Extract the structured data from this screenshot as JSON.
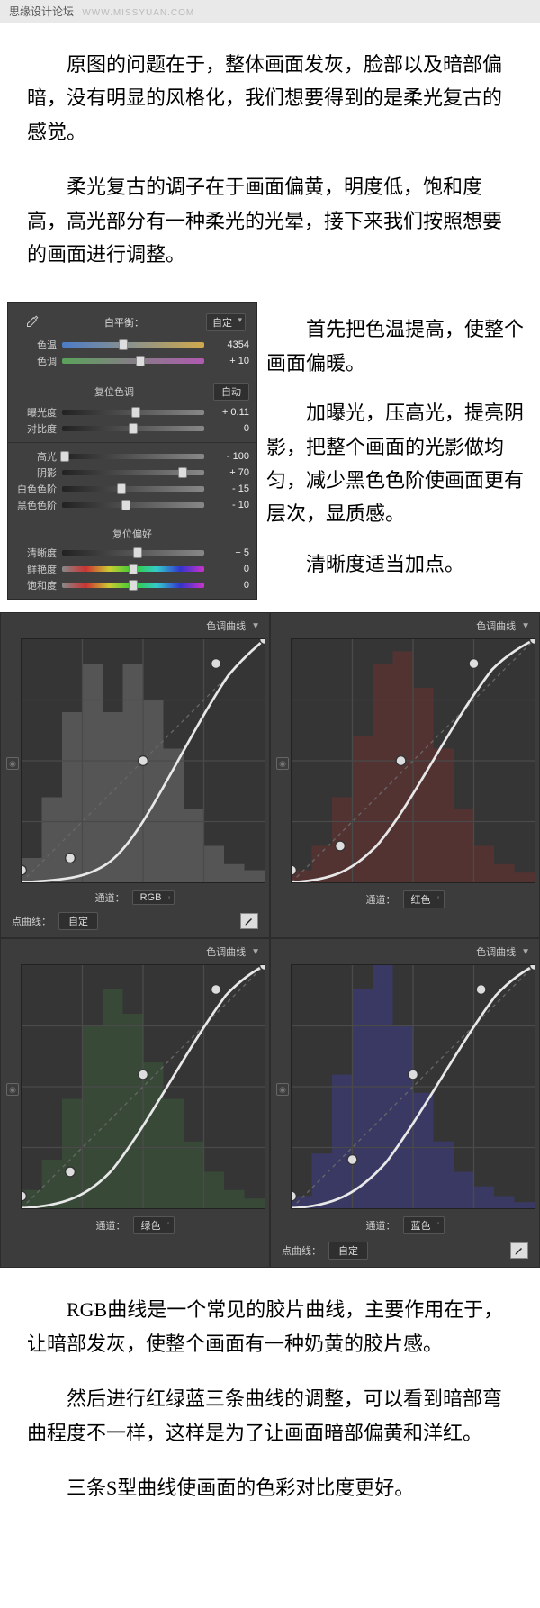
{
  "header": {
    "site": "思缘设计论坛",
    "url": "WWW.MISSYUAN.COM"
  },
  "intro": [
    "原图的问题在于，整体画面发灰，脸部以及暗部偏暗，没有明显的风格化，我们想要得到的是柔光复古的感觉。",
    "柔光复古的调子在于画面偏黄，明度低，饱和度高，高光部分有一种柔光的光晕，接下来我们按照想要的画面进行调整。"
  ],
  "basic": {
    "wb_label": "白平衡：",
    "wb_preset": "自定",
    "sliders1": [
      {
        "label": "色温",
        "value": "4354",
        "pos": 43,
        "track": "temp"
      },
      {
        "label": "色调",
        "value": "+ 10",
        "pos": 55,
        "track": "tint"
      }
    ],
    "section_tone": {
      "title": "复位色调",
      "auto": "自动"
    },
    "sliders2": [
      {
        "label": "曝光度",
        "value": "+ 0.11",
        "pos": 52,
        "track": "dark"
      },
      {
        "label": "对比度",
        "value": "0",
        "pos": 50,
        "track": "dark"
      }
    ],
    "sliders3": [
      {
        "label": "高光",
        "value": "- 100",
        "pos": 2,
        "track": "dark"
      },
      {
        "label": "阴影",
        "value": "+ 70",
        "pos": 85,
        "track": "dark"
      },
      {
        "label": "白色色阶",
        "value": "- 15",
        "pos": 42,
        "track": "dark"
      },
      {
        "label": "黑色色阶",
        "value": "- 10",
        "pos": 45,
        "track": "dark"
      }
    ],
    "section_pref": {
      "title": "复位偏好"
    },
    "sliders4": [
      {
        "label": "清晰度",
        "value": "+ 5",
        "pos": 53,
        "track": "dark"
      },
      {
        "label": "鲜艳度",
        "value": "0",
        "pos": 50,
        "track": "sat"
      },
      {
        "label": "饱和度",
        "value": "0",
        "pos": 50,
        "track": "sat"
      }
    ]
  },
  "basic_side": [
    "首先把色温提高，使整个画面偏暖。",
    "加曝光，压高光，提亮阴影，把整个画面的光影做均匀，减少黑色色阶使画面更有层次，显质感。",
    "清晰度适当加点。"
  ],
  "curves": {
    "title": "色调曲线",
    "channel_label": "通道：",
    "panels": [
      {
        "channel": "RGB",
        "hist": "#707070",
        "pts": [
          [
            0,
            5
          ],
          [
            20,
            10
          ],
          [
            50,
            50
          ],
          [
            80,
            90
          ],
          [
            100,
            100
          ]
        ],
        "line": "M 0 200 C 40 198, 55 195, 70 185 C 100 165, 130 90, 170 30 C 185 12, 195 5, 200 0",
        "point_curve_label": "点曲线：",
        "point_curve_value": "自定"
      },
      {
        "channel": "红色",
        "hist": "#6b3030",
        "pts": [
          [
            0,
            5
          ],
          [
            20,
            15
          ],
          [
            45,
            50
          ],
          [
            75,
            90
          ],
          [
            100,
            100
          ]
        ],
        "line": "M 0 200 C 35 198, 50 190, 70 170 C 100 135, 130 70, 165 25 C 180 10, 195 3, 200 0"
      },
      {
        "channel": "绿色",
        "hist": "#3a5a3a",
        "pts": [
          [
            0,
            5
          ],
          [
            20,
            15
          ],
          [
            50,
            55
          ],
          [
            80,
            90
          ],
          [
            100,
            100
          ]
        ],
        "line": "M 0 200 C 35 198, 55 190, 75 168 C 105 130, 135 70, 168 25 C 182 10, 195 3, 200 0"
      },
      {
        "channel": "蓝色",
        "hist": "#3c3c8a",
        "pts": [
          [
            0,
            5
          ],
          [
            25,
            20
          ],
          [
            50,
            55
          ],
          [
            78,
            90
          ],
          [
            100,
            100
          ]
        ],
        "line": "M 0 200 C 35 198, 55 188, 78 162 C 108 122, 138 65, 168 25 C 182 10, 195 3, 200 0",
        "point_curve_label": "点曲线：",
        "point_curve_value": "自定"
      }
    ]
  },
  "outro": [
    "RGB曲线是一个常见的胶片曲线，主要作用在于，让暗部发灰，使整个画面有一种奶黄的胶片感。",
    "然后进行红绿蓝三条曲线的调整，可以看到暗部弯曲程度不一样，这样是为了让画面暗部偏黄和洋红。",
    "三条S型曲线使画面的色彩对比度更好。"
  ]
}
